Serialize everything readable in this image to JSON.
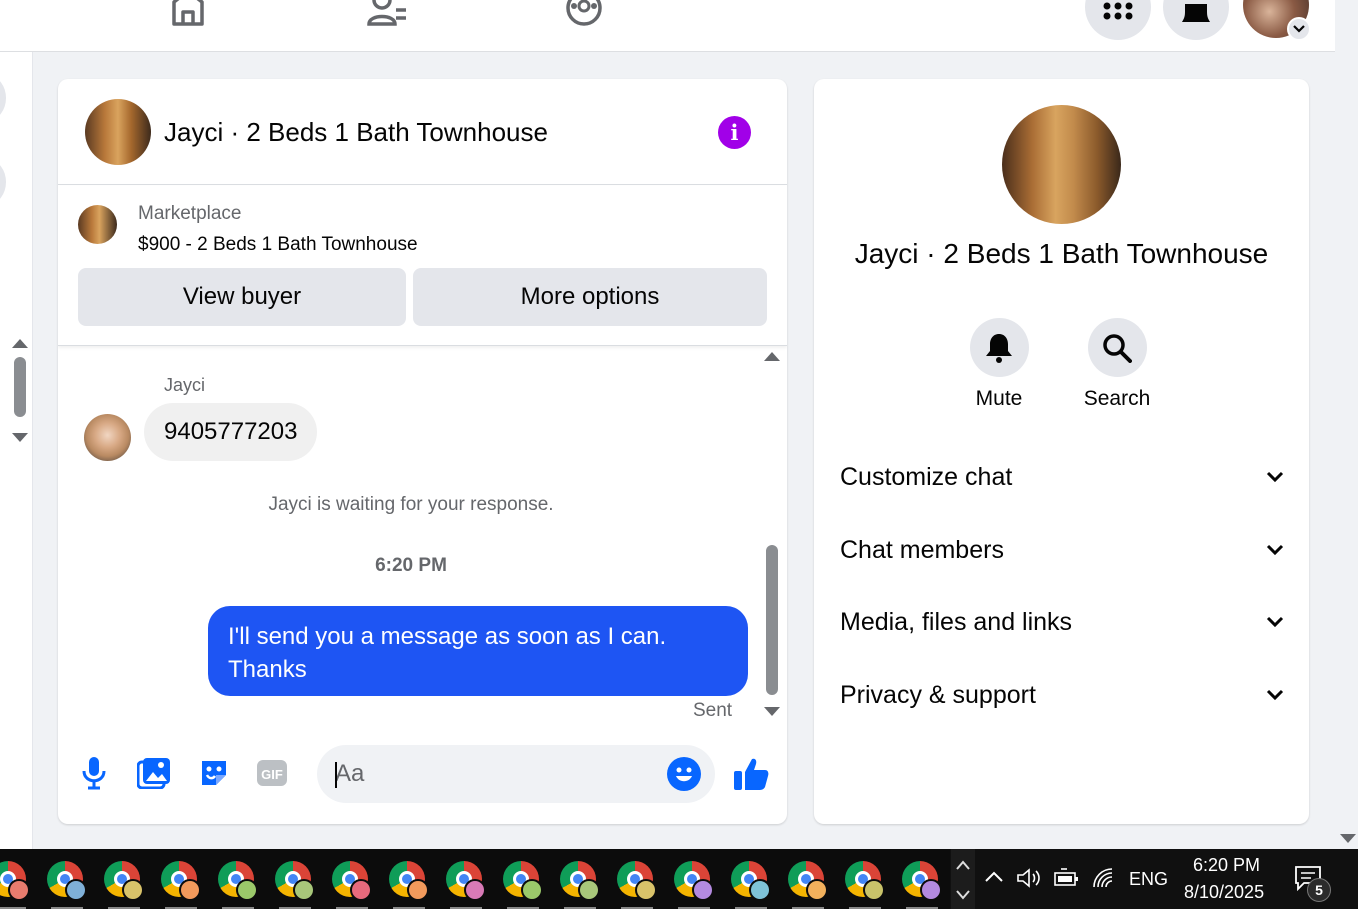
{
  "chat": {
    "title": "Jayci · 2 Beds 1 Bath Townhouse",
    "listing": {
      "source": "Marketplace",
      "title": "$900 - 2 Beds 1 Bath Townhouse"
    },
    "buttons": {
      "view_buyer": "View buyer",
      "more_options": "More options"
    },
    "messages": {
      "sender_name": "Jayci",
      "incoming_text": "9405777203",
      "waiting_notice": "Jayci is waiting for your response.",
      "timestamp": "6:20 PM",
      "outgoing_text": "I'll send you a message as soon as I can. Thanks",
      "status": "Sent"
    },
    "composer": {
      "placeholder": "Aa"
    }
  },
  "sidebar": {
    "title": "Jayci · 2 Beds 1 Bath Townhouse",
    "actions": {
      "mute": "Mute",
      "search": "Search"
    },
    "sections": [
      {
        "label": "Customize chat"
      },
      {
        "label": "Chat members"
      },
      {
        "label": "Media, files and links"
      },
      {
        "label": "Privacy & support"
      }
    ]
  },
  "taskbar": {
    "language": "ENG",
    "time": "6:20 PM",
    "date": "8/10/2025",
    "notification_count": "5",
    "profile_colors": [
      "#e87c6e",
      "#7fb0d8",
      "#d9c36a",
      "#f29a5c",
      "#9bc96a",
      "#a8c77a",
      "#e86a7c",
      "#f29a5c",
      "#d87ab6",
      "#9bc96a",
      "#a8c77a",
      "#d9c36a",
      "#b48ae0",
      "#7fc3d8",
      "#f2b05c",
      "#c9c36a",
      "#b48ae0"
    ]
  },
  "colors": {
    "accent_blue": "#0866ff",
    "outgoing_bubble": "#1e55f3",
    "info_purple": "#a100e8"
  }
}
